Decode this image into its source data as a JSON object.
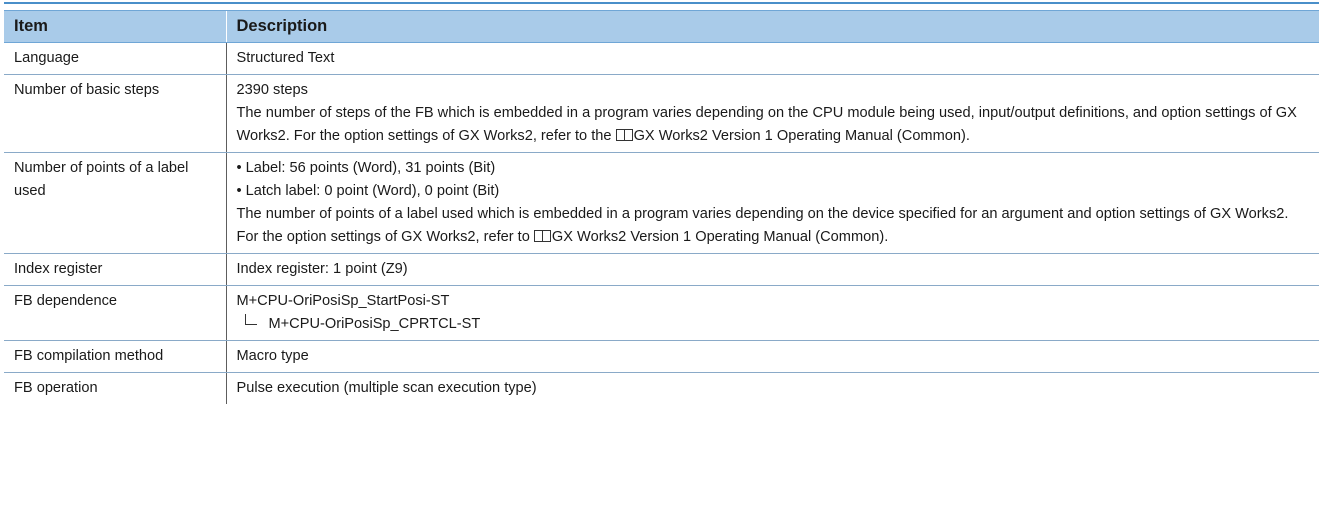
{
  "header": {
    "item": "Item",
    "description": "Description"
  },
  "rows": {
    "language": {
      "item": "Language",
      "description": "Structured Text"
    },
    "basic_steps": {
      "item": "Number of basic steps",
      "value": "2390 steps",
      "note_text": "The number of steps of the FB which is embedded in a program varies depending on the CPU module being used, input/output definitions, and option settings of GX Works2. For the option settings of GX Works2, refer to the ",
      "ref_icon": "manual-book-icon",
      "ref_text": "GX Works2 Version 1 Operating Manual (Common)."
    },
    "label_points": {
      "item": "Number of points of a label used",
      "bullets": [
        "Label: 56 points (Word), 31 points (Bit)",
        "Latch label: 0 point (Word), 0 point (Bit)"
      ],
      "note_text": "The number of points of a label used which is embedded in a program varies depending on the device specified for an argument and option settings of GX Works2. For the option settings of GX Works2, refer to ",
      "ref_icon": "manual-book-icon",
      "ref_text": "GX Works2 Version 1 Operating Manual (Common)."
    },
    "index_register": {
      "item": "Index register",
      "description": "Index register: 1 point (Z9)"
    },
    "fb_dependence": {
      "item": "FB dependence",
      "parent": "M+CPU-OriPosiSp_StartPosi-ST",
      "child": "M+CPU-OriPosiSp_CPRTCL-ST"
    },
    "compilation": {
      "item": "FB compilation method",
      "description": "Macro type"
    },
    "operation": {
      "item": "FB operation",
      "description": "Pulse execution (multiple scan execution type)"
    }
  },
  "colors": {
    "header_bg": "#a9cbe9",
    "rule": "#4a8fc9"
  }
}
